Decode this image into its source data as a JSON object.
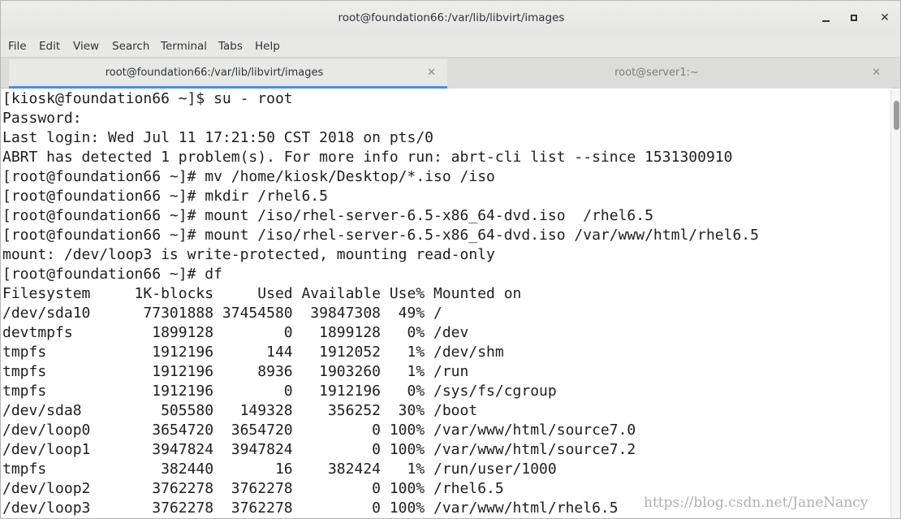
{
  "window": {
    "title": "root@foundation66:/var/lib/libvirt/images",
    "minimize_label": "",
    "maximize_label": "",
    "close_label": "✕"
  },
  "menubar": {
    "items": [
      "File",
      "Edit",
      "View",
      "Search",
      "Terminal",
      "Tabs",
      "Help"
    ]
  },
  "tabs": [
    {
      "label": "root@foundation66:/var/lib/libvirt/images",
      "close": "✕",
      "active": true
    },
    {
      "label": "root@server1:~",
      "close": "✕",
      "active": false
    }
  ],
  "terminal": {
    "lines": [
      "[kiosk@foundation66 ~]$ su - root",
      "Password:",
      "Last login: Wed Jul 11 17:21:50 CST 2018 on pts/0",
      "ABRT has detected 1 problem(s). For more info run: abrt-cli list --since 1531300910",
      "[root@foundation66 ~]# mv /home/kiosk/Desktop/*.iso /iso",
      "[root@foundation66 ~]# mkdir /rhel6.5",
      "[root@foundation66 ~]# mount /iso/rhel-server-6.5-x86_64-dvd.iso  /rhel6.5",
      "[root@foundation66 ~]# mount /iso/rhel-server-6.5-x86_64-dvd.iso /var/www/html/rhel6.5",
      "mount: /dev/loop3 is write-protected, mounting read-only",
      "[root@foundation66 ~]# df",
      "Filesystem     1K-blocks     Used Available Use% Mounted on",
      "/dev/sda10      77301888 37454580  39847308  49% /",
      "devtmpfs         1899128        0   1899128   0% /dev",
      "tmpfs            1912196      144   1912052   1% /dev/shm",
      "tmpfs            1912196     8936   1903260   1% /run",
      "tmpfs            1912196        0   1912196   0% /sys/fs/cgroup",
      "/dev/sda8         505580   149328    356252  30% /boot",
      "/dev/loop0       3654720  3654720         0 100% /var/www/html/source7.0",
      "/dev/loop1       3947824  3947824         0 100% /var/www/html/source7.2",
      "tmpfs             382440       16    382424   1% /run/user/1000",
      "/dev/loop2       3762278  3762278         0 100% /rhel6.5",
      "/dev/loop3       3762278  3762278         0 100% /var/www/html/rhel6.5"
    ]
  },
  "watermark": "https://blog.csdn.net/JaneNancy",
  "colors": {
    "terminal_bg": "#ffffff",
    "terminal_fg": "#1e1e1e",
    "active_tab_indicator": "#4a90d9",
    "chrome_bg": "#e8e8e7"
  }
}
